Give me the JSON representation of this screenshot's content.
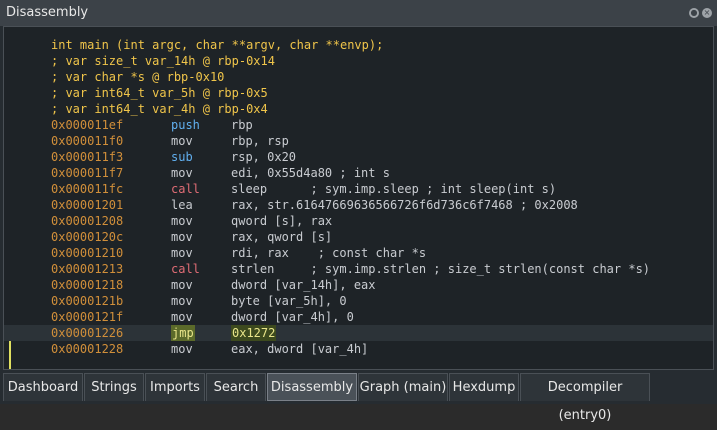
{
  "window": {
    "title": "Disassembly"
  },
  "header_lines": [
    "int main (int argc, char **argv, char **envp);",
    "; var size_t var_14h @ rbp-0x14",
    "; var char *s @ rbp-0x10",
    "; var int64_t var_5h @ rbp-0x5",
    "; var int64_t var_4h @ rbp-0x4"
  ],
  "instructions": [
    {
      "addr": "0x000011ef",
      "mn": "push",
      "ops": "rbp"
    },
    {
      "addr": "0x000011f0",
      "mn": "mov",
      "ops": "rbp, rsp"
    },
    {
      "addr": "0x000011f3",
      "mn": "sub",
      "ops": "rsp, 0x20"
    },
    {
      "addr": "0x000011f7",
      "mn": "mov",
      "ops": "edi, 0x55d4a80 ; int s"
    },
    {
      "addr": "0x000011fc",
      "mn": "call",
      "ops": "sleep      ; sym.imp.sleep ; int sleep(int s)"
    },
    {
      "addr": "0x00001201",
      "mn": "lea",
      "ops": "rax, str.61647669636566726f6d736c6f7468 ; 0x2008"
    },
    {
      "addr": "0x00001208",
      "mn": "mov",
      "ops": "qword [s], rax"
    },
    {
      "addr": "0x0000120c",
      "mn": "mov",
      "ops": "rax, qword [s]"
    },
    {
      "addr": "0x00001210",
      "mn": "mov",
      "ops": "rdi, rax    ; const char *s"
    },
    {
      "addr": "0x00001213",
      "mn": "call",
      "ops": "strlen     ; sym.imp.strlen ; size_t strlen(const char *s)"
    },
    {
      "addr": "0x00001218",
      "mn": "mov",
      "ops": "dword [var_14h], eax"
    },
    {
      "addr": "0x0000121b",
      "mn": "mov",
      "ops": "byte [var_5h], 0"
    },
    {
      "addr": "0x0000121f",
      "mn": "mov",
      "ops": "dword [var_4h], 0"
    },
    {
      "addr": "0x00001226",
      "mn": "jmp",
      "ops": "0x1272"
    },
    {
      "addr": "0x00001228",
      "mn": "mov",
      "ops": "eax, dword [var_4h]"
    }
  ],
  "highlighted_index": 13,
  "tabs": [
    "Dashboard",
    "Strings",
    "Imports",
    "Search",
    "Disassembly",
    "Graph (main)",
    "Hexdump",
    "Decompiler (entry0)"
  ],
  "active_tab": "Disassembly",
  "colors": {
    "background": "#1e2327",
    "address": "#d18f3a",
    "call": "#e06c75",
    "comment": "#56b6c2",
    "jump_arrow": "#e0e060"
  }
}
